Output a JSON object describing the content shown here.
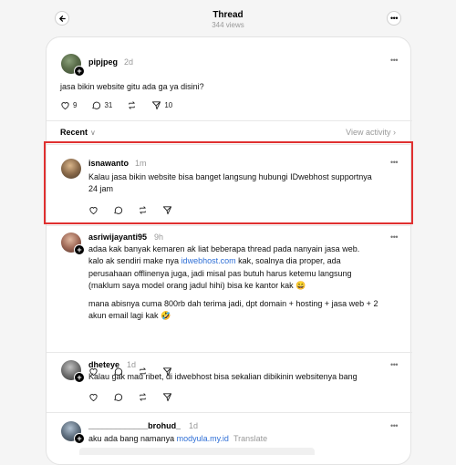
{
  "header": {
    "title": "Thread",
    "views": "344 views"
  },
  "main_post": {
    "username": "pipjpeg",
    "time": "2d",
    "text": "jasa bikin website gitu ada ga ya disini?",
    "likes": "9",
    "replies": "31",
    "shares": "10"
  },
  "sort": {
    "label": "Recent",
    "view_activity": "View activity"
  },
  "replies": [
    {
      "username": "isnawanto",
      "time": "1m",
      "lines": [
        "Kalau jasa bikin website bisa banget langsung hubungi IDwebhost supportnya",
        "24 jam"
      ]
    },
    {
      "username": "asriwijayanti95",
      "time": "9h",
      "line1": "adaa kak banyak kemaren ak liat beberapa thread pada nanyain jasa web.",
      "line2_pre": "kalo ak sendiri make nya ",
      "line2_link": "idwebhost.com",
      "line2_post": " kak, soalnya dia proper, ada",
      "line3": "perusahaan offlinenya juga, jadi misal pas butuh harus ketemu langsung",
      "line4": "(maklum saya model orang jadul hihi) bisa ke kantor kak 😄",
      "para2_line1": "mana abisnya cuma 800rb dah terima jadi, dpt domain + hosting + jasa web + 2",
      "para2_line2": "akun email lagi kak 🤣"
    },
    {
      "username": "dheteye",
      "time": "1d",
      "text": "Kalau gak mau ribet, di idwebhost bisa sekalian dibikinin websitenya bang"
    },
    {
      "username": "_____________brohud_",
      "time": "1d",
      "text_pre": "aku ada bang namanya ",
      "link": "modyula.my.id",
      "translate": "Translate"
    }
  ],
  "colors": {
    "highlight": "#e03030",
    "link": "#2f6fd6"
  }
}
